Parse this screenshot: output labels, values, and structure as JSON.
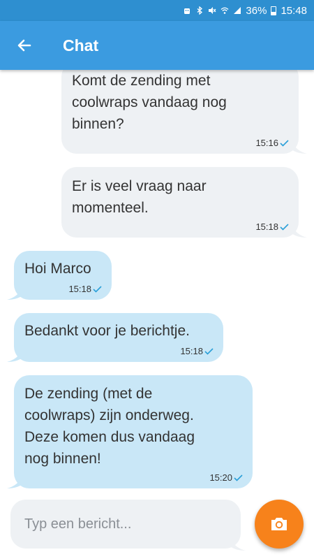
{
  "status_bar": {
    "battery_percent": "36%",
    "time": "15:48",
    "icons": [
      "android-icon",
      "bluetooth-icon",
      "mute-icon",
      "wifi-icon",
      "signal-icon",
      "battery-icon"
    ]
  },
  "header": {
    "title": "Chat",
    "back_icon": "arrow-back-icon",
    "background": "#3b9be0"
  },
  "messages": [
    {
      "direction": "outgoing",
      "text": "Komt de zending met\ncoolwraps vandaag nog\nbinnen?",
      "time": "15:16",
      "read": true
    },
    {
      "direction": "outgoing",
      "text": "Er is veel vraag naar\nmomenteel.",
      "time": "15:18",
      "read": true
    },
    {
      "direction": "incoming",
      "text": "Hoi Marco",
      "time": "15:18",
      "read": true
    },
    {
      "direction": "incoming",
      "text": "Bedankt voor je berichtje.",
      "time": "15:18",
      "read": true
    },
    {
      "direction": "incoming",
      "text": "De zending (met de\ncoolwraps) zijn onderweg.\nDeze komen dus vandaag\nnog binnen!",
      "time": "15:20",
      "read": true
    }
  ],
  "composer": {
    "placeholder": "Typ een bericht...",
    "value": "",
    "send_icon": "camera-icon",
    "accent": "#f7821b"
  },
  "colors": {
    "outgoing_bubble": "#eef1f4",
    "incoming_bubble": "#c9e7f7",
    "check": "#2a9fd8"
  }
}
